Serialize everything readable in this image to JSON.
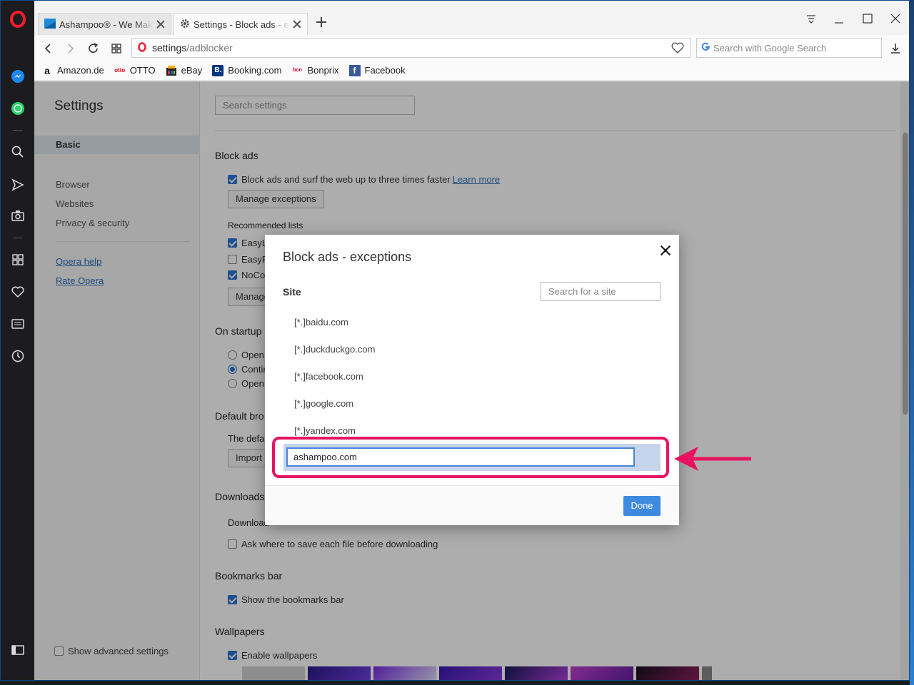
{
  "browser": {
    "tabs": [
      {
        "title": "Ashampoo® - We Make S",
        "active": false
      },
      {
        "title": "Settings - Block ads - exce",
        "active": true
      }
    ],
    "address": {
      "host": "settings",
      "path": "/adblocker"
    },
    "search_placeholder": "Search with Google Search",
    "bookmarks": [
      "Amazon.de",
      "OTTO",
      "eBay",
      "Booking.com",
      "Bonprix",
      "Facebook"
    ]
  },
  "settings": {
    "title": "Settings",
    "nav": {
      "basic": "Basic",
      "items": [
        "Browser",
        "Websites",
        "Privacy & security"
      ],
      "help": "Opera help",
      "rate": "Rate Opera",
      "advanced": "Show advanced settings"
    },
    "search_placeholder": "Search settings",
    "block_ads": {
      "title": "Block ads",
      "checkbox": "Block ads and surf the web up to three times faster",
      "learn_more": "Learn more",
      "manage_btn": "Manage exceptions",
      "recommended_title": "Recommended lists",
      "lists": [
        "EasyLis",
        "EasyPr",
        "NoCoi"
      ],
      "manage_btn2": "Manage"
    },
    "startup": {
      "title": "On startup",
      "options": [
        "Open",
        "Contin",
        "Open"
      ]
    },
    "default_browser": {
      "title": "Default bro",
      "text": "The defau",
      "import_btn": "Import"
    },
    "downloads": {
      "title": "Downloads",
      "label": "Download",
      "ask": "Ask where to save each file before downloading"
    },
    "bookmarks_bar": {
      "title": "Bookmarks bar",
      "show": "Show the bookmarks bar"
    },
    "wallpapers": {
      "title": "Wallpapers",
      "enable": "Enable wallpapers"
    }
  },
  "dialog": {
    "title": "Block ads - exceptions",
    "site_header": "Site",
    "search_placeholder": "Search for a site",
    "sites": [
      "[*.]baidu.com",
      "[*.]duckduckgo.com",
      "[*.]facebook.com",
      "[*.]google.com",
      "[*.]yandex.com"
    ],
    "input_value": "ashampoo.com",
    "done": "Done"
  },
  "colors": {
    "accent": "#3e8ae0",
    "annotation": "#e81360"
  }
}
